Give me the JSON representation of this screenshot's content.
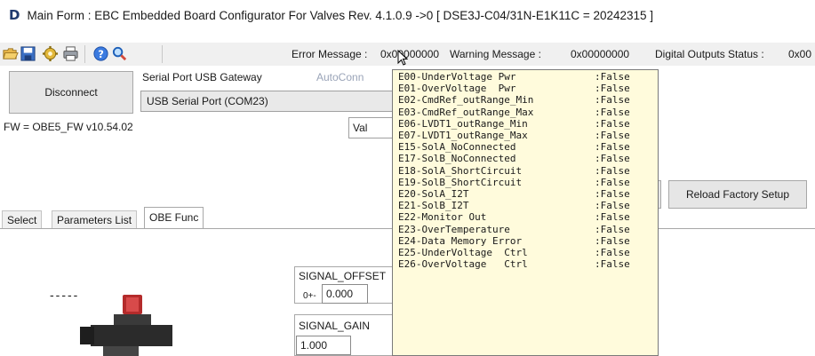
{
  "window": {
    "logo": "D",
    "title": "Main Form : EBC Embedded Board Configurator For Valves  Rev. 4.1.0.9 ->0 [ DSE3J-C04/31N-E1K11C = 20242315 ]"
  },
  "toolbar": {
    "icons": [
      "folder-open-icon",
      "save-icon",
      "gear-icon",
      "print-icon",
      "help-icon",
      "search-icon"
    ],
    "error_label": "Error Message :",
    "error_value": "0x00000000",
    "warning_label": "Warning Message :",
    "warning_value": "0x00000000",
    "digital_label": "Digital Outputs Status :",
    "digital_value": "0x00"
  },
  "connection": {
    "disconnect_label": "Disconnect",
    "gateway_label": "Serial Port USB Gateway",
    "autoconn_label": "AutoConn",
    "port_value": "USB Serial Port (COM23)",
    "fw_label": "FW = OBE5_FW v10.54.02",
    "val_text": "Val"
  },
  "buttons": {
    "reload_label": "Reload Factory Setup"
  },
  "tabs": [
    "Select",
    "Parameters List",
    "OBE Func"
  ],
  "active_tab": "OBE Func",
  "panel": {
    "dashes": "-----",
    "signal_offset_label": "SIGNAL_OFFSET",
    "offset_prefix": "0+-",
    "offset_value": "0.000",
    "signal_gain_label": "SIGNAL_GAIN",
    "gain_value": "1.000"
  },
  "error_tooltip": {
    "items": [
      {
        "code": "E00-UnderVoltage Pwr",
        "value": ":False"
      },
      {
        "code": "E01-OverVoltage  Pwr",
        "value": ":False"
      },
      {
        "code": "E02-CmdRef_outRange_Min",
        "value": ":False"
      },
      {
        "code": "E03-CmdRef_outRange_Max",
        "value": ":False"
      },
      {
        "code": "E06-LVDT1_outRange_Min",
        "value": ":False"
      },
      {
        "code": "E07-LVDT1_outRange_Max",
        "value": ":False"
      },
      {
        "code": "E15-SolA_NoConnected",
        "value": ":False"
      },
      {
        "code": "E17-SolB_NoConnected",
        "value": ":False"
      },
      {
        "code": "E18-SolA_ShortCircuit",
        "value": ":False"
      },
      {
        "code": "E19-SolB_ShortCircuit",
        "value": ":False"
      },
      {
        "code": "E20-SolA_I2T",
        "value": ":False"
      },
      {
        "code": "E21-SolB_I2T",
        "value": ":False"
      },
      {
        "code": "E22-Monitor Out",
        "value": ":False"
      },
      {
        "code": "E23-OverTemperature",
        "value": ":False"
      },
      {
        "code": "E24-Data Memory Error",
        "value": ":False"
      },
      {
        "code": "E25-UnderVoltage  Ctrl",
        "value": ":False"
      },
      {
        "code": "E26-OverVoltage   Ctrl",
        "value": ":False"
      }
    ]
  },
  "colors": {
    "tooltip_bg": "#fffbdc",
    "toolbar_bg": "#f0f0f0",
    "autoconn_disabled": "#9aa4b8",
    "logo": "#1f3a6e"
  }
}
